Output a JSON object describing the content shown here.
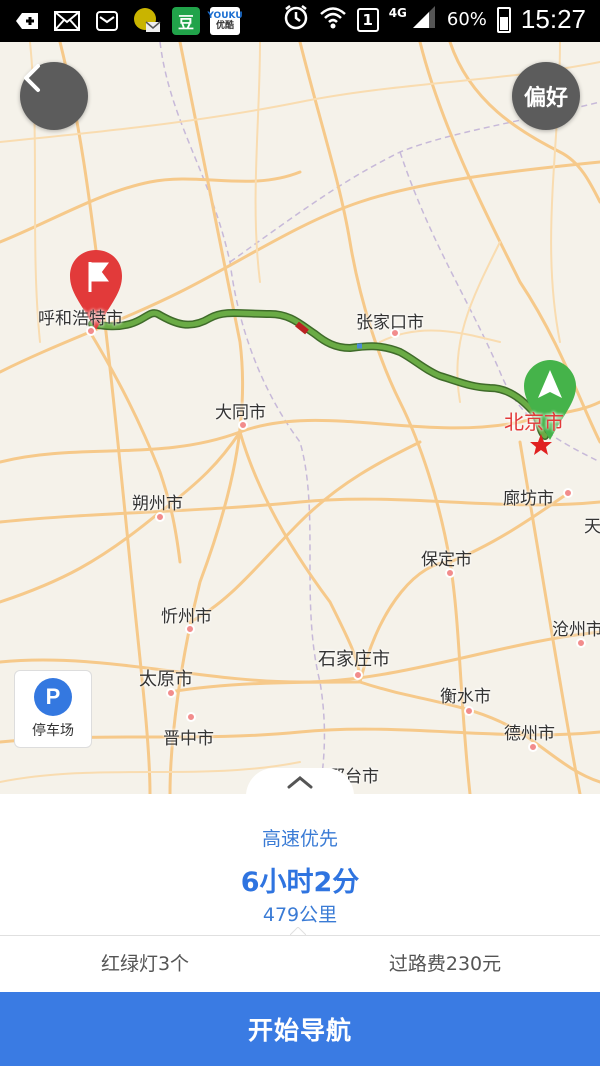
{
  "status_bar": {
    "icons": [
      "plus-icon",
      "mail-icon",
      "message-icon",
      "app-icon",
      "douban-icon",
      "youku-icon",
      "alarm-icon",
      "wifi-icon",
      "sim-icon",
      "signal-icon",
      "battery-icon"
    ],
    "douban": "豆",
    "youku": "YOUKU",
    "youku_sub": "优酷",
    "sim_slot": "1",
    "network": "4G",
    "battery": "60%",
    "time": "15:27"
  },
  "map": {
    "preference_label": "偏好",
    "parking_label": "停车场",
    "parking_symbol": "P",
    "cities": {
      "hohhot": "呼和浩特市",
      "zhangjiakou": "张家口市",
      "datong": "大同市",
      "beijing": "北京市",
      "shuozhou": "朔州市",
      "langfang": "廊坊市",
      "tianjin": "天",
      "baoding": "保定市",
      "xinzhou": "忻州市",
      "cangzhou": "沧州市",
      "shijiazhuang": "石家庄市",
      "taiyuan": "太原市",
      "hengshui": "衡水市",
      "jinzhong": "晋中市",
      "dezhou": "德州市",
      "xingtai": "邢台市"
    },
    "colors": {
      "route": "#5e9b3b",
      "start_marker": "#e23a3a",
      "end_marker": "#3aa53a",
      "road": "#f6c98a"
    }
  },
  "route": {
    "type": "高速优先",
    "duration": "6小时2分",
    "distance": "479公里",
    "traffic_lights": "红绿灯3个",
    "toll": "过路费230元"
  },
  "actions": {
    "start_navigation": "开始导航"
  }
}
